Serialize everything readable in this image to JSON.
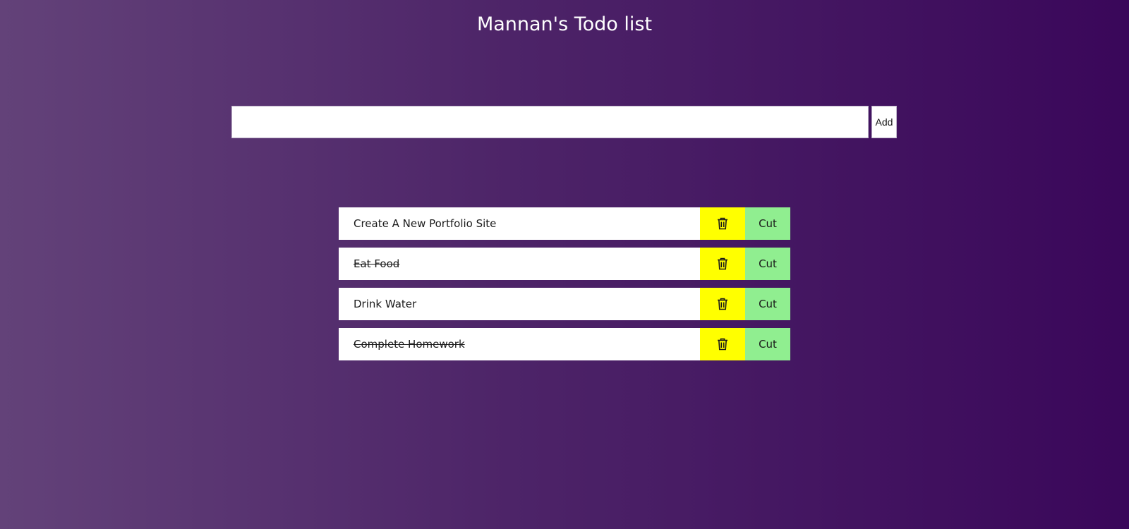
{
  "header": {
    "title": "Mannan's Todo list"
  },
  "input": {
    "value": "",
    "add_label": "Add"
  },
  "todos": [
    {
      "text": "Create A New Portfolio Site",
      "done": false,
      "cut_label": "Cut",
      "delete_icon": "trash-icon"
    },
    {
      "text": "Eat Food",
      "done": true,
      "cut_label": "Cut",
      "delete_icon": "trash-icon"
    },
    {
      "text": "Drink Water",
      "done": false,
      "cut_label": "Cut",
      "delete_icon": "trash-icon"
    },
    {
      "text": "Complete Homework",
      "done": true,
      "cut_label": "Cut",
      "delete_icon": "trash-icon"
    }
  ],
  "colors": {
    "background_start": "#634279",
    "background_end": "#3a075a",
    "delete_button": "#ffff00",
    "cut_button": "#90ee90"
  }
}
